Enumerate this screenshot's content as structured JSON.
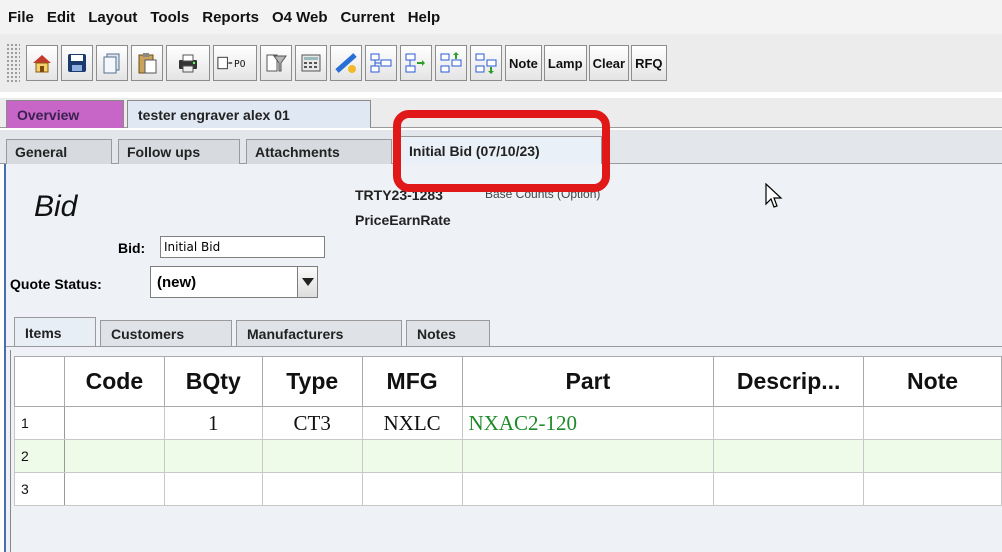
{
  "menu": [
    "File",
    "Edit",
    "Layout",
    "Tools",
    "Reports",
    "O4 Web",
    "Current",
    "Help"
  ],
  "toolbar": {
    "icons": [
      "home-icon",
      "save-icon",
      "copy-icon",
      "paste-icon",
      "print-icon",
      "po-icon",
      "filter-icon",
      "calculator-icon",
      "report-icon",
      "move-left-icon",
      "move-right-icon",
      "move-up-icon",
      "move-down-icon"
    ],
    "po_label": "PO",
    "text_buttons": [
      "Note",
      "Lamp",
      "Clear",
      "RFQ"
    ]
  },
  "outer_tabs": [
    {
      "label": "Overview"
    },
    {
      "label": "tester engraver alex 01"
    }
  ],
  "inner_tabs": [
    {
      "label": "General"
    },
    {
      "label": "Follow ups"
    },
    {
      "label": "Attachments"
    },
    {
      "label": "Initial Bid (07/10/23)"
    }
  ],
  "bid": {
    "title": "Bid",
    "code": "TRTY23-1283",
    "base_counts": "Base Counts (Option)",
    "price_earn_rate": "PriceEarnRate",
    "bid_label": "Bid:",
    "bid_value": "Initial Bid",
    "quote_status_label": "Quote Status:",
    "quote_status_value": "(new)"
  },
  "sub_tabs": [
    {
      "label": "Items"
    },
    {
      "label": "Customers"
    },
    {
      "label": "Manufacturers"
    },
    {
      "label": "Notes"
    }
  ],
  "table": {
    "columns": [
      "",
      "Code",
      "BQty",
      "Type",
      "MFG",
      "Part",
      "Descrip...",
      "Note"
    ],
    "rows": [
      {
        "num": "1",
        "code": "",
        "bqty": "1",
        "type": "CT3",
        "mfg": "NXLC",
        "part": "NXAC2-120",
        "desc": "",
        "note": ""
      },
      {
        "num": "2",
        "code": "",
        "bqty": "",
        "type": "",
        "mfg": "",
        "part": "",
        "desc": "",
        "note": ""
      },
      {
        "num": "3",
        "code": "",
        "bqty": "",
        "type": "",
        "mfg": "",
        "part": "",
        "desc": "",
        "note": ""
      }
    ]
  },
  "colors": {
    "overview_tab": "#c866c8",
    "highlight": "#e01818",
    "part_text": "#1f8a2a",
    "selected_row": "#eefbe9"
  }
}
